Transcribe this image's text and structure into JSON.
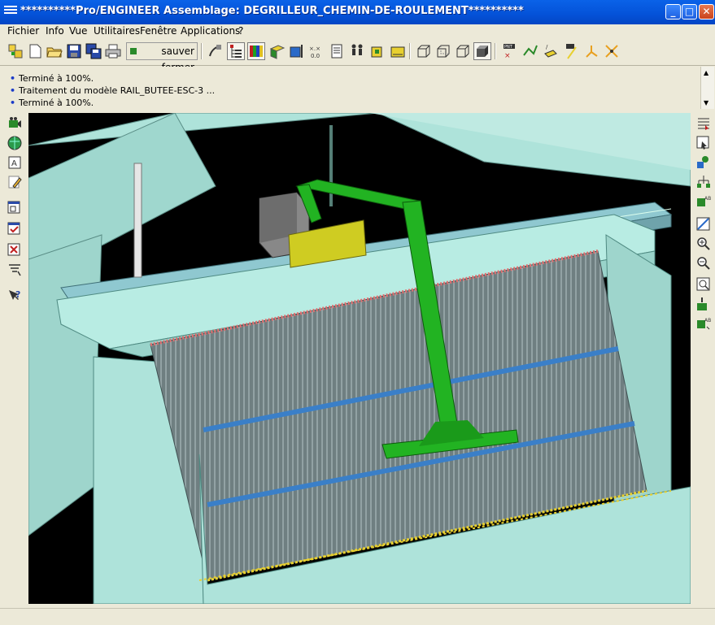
{
  "window": {
    "title": "**********Pro/ENGINEER Assemblage: DEGRILLEUR_CHEMIN-DE-ROULEMENT**********",
    "min_glyph": "_",
    "max_glyph": "□",
    "close_glyph": "✕"
  },
  "menu": {
    "items": [
      "Fichier",
      "Info",
      "Vue",
      "Utilitaires",
      "Fenêtre",
      "Applications",
      "?"
    ]
  },
  "toolbar": {
    "sauver_label": "sauver fermer",
    "icons": [
      "assembly-icon",
      "new-icon",
      "open-icon",
      "save-icon",
      "save-copy-icon",
      "print-icon",
      "sauver-fermer-button",
      "repaint-icon",
      "model-tree-icon",
      "layer-icon",
      "datum-plane-icon",
      "datum-axis-icon",
      "datum-point-icon",
      "csys-icon",
      "spin-center-icon",
      "view-manager-icon",
      "saved-views-icon",
      "wireframe-icon",
      "hidden-line-icon",
      "no-hidden-icon",
      "shading-icon",
      "datum-point-tool-icon",
      "sketch-curve-icon",
      "datum-plane-tool-icon",
      "datum-axis-tool-icon",
      "datum-csys-tool-icon",
      "analysis-icon"
    ]
  },
  "messages": [
    "Terminé à 100%.",
    "Traitement du modèle RAIL_BUTEE-ESC-3 ...",
    "Terminé à 100%."
  ],
  "left_toolbar": {
    "icons": [
      "camera-icon",
      "globe-icon",
      "annotation-icon",
      "pencil-icon",
      "window-icon",
      "activate-window-icon",
      "close-window-icon",
      "filter-icon",
      "help-icon"
    ]
  },
  "right_toolbar": {
    "icons": [
      "layer-tree-icon",
      "select-icon",
      "assemble-icon",
      "explode-icon",
      "datum-tag-icon",
      "refit-icon",
      "zoom-in-icon",
      "zoom-out-icon",
      "zoom-fit-icon",
      "reorient-icon",
      "display-style-icon"
    ]
  },
  "colors": {
    "titlebar": "#0452d8",
    "concrete": "#aee3da",
    "gantry": "#22b322",
    "motor_box": "#cfcc22",
    "rail": "#8fc8d0",
    "grid_bars": "#7c8e90",
    "viewport_bg": "#000000"
  }
}
